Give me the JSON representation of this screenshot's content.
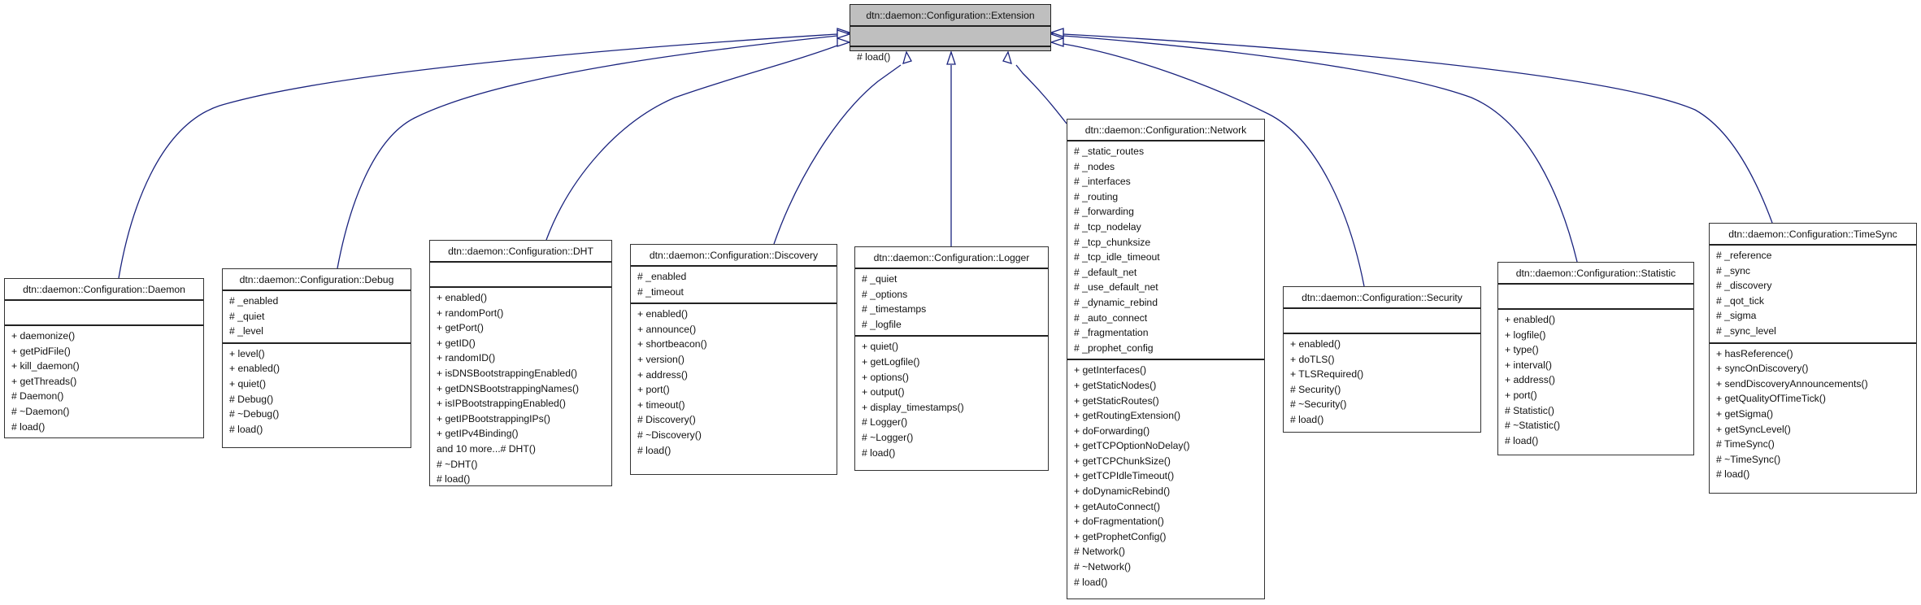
{
  "diagram": {
    "type": "class-inheritance",
    "edge_color": "#1a237e",
    "base_fill": "#bfbfbf",
    "base": {
      "name": "dtn::daemon::Configuration::Extension",
      "attributes": [],
      "operations": [
        "# load()"
      ]
    },
    "classes": [
      {
        "id": "daemon",
        "name": "dtn::daemon::Configuration::Daemon",
        "attributes": [],
        "operations": [
          "+ daemonize()",
          "+ getPidFile()",
          "+ kill_daemon()",
          "+ getThreads()",
          "# Daemon()",
          "# ~Daemon()",
          "# load()"
        ]
      },
      {
        "id": "debug",
        "name": "dtn::daemon::Configuration::Debug",
        "attributes": [
          "# _enabled",
          "# _quiet",
          "# _level"
        ],
        "operations": [
          "+ level()",
          "+ enabled()",
          "+ quiet()",
          "# Debug()",
          "# ~Debug()",
          "# load()"
        ]
      },
      {
        "id": "dht",
        "name": "dtn::daemon::Configuration::DHT",
        "attributes": [],
        "operations": [
          "+ enabled()",
          "+ randomPort()",
          "+ getPort()",
          "+ getID()",
          "+ randomID()",
          "+ isDNSBootstrappingEnabled()",
          "+ getDNSBootstrappingNames()",
          "+ isIPBootstrappingEnabled()",
          "+ getIPBootstrappingIPs()",
          "+ getIPv4Binding()",
          "and 10 more...# DHT()",
          "# ~DHT()",
          "# load()"
        ]
      },
      {
        "id": "discovery",
        "name": "dtn::daemon::Configuration::Discovery",
        "attributes": [
          "# _enabled",
          "# _timeout"
        ],
        "operations": [
          "+ enabled()",
          "+ announce()",
          "+ shortbeacon()",
          "+ version()",
          "+ address()",
          "+ port()",
          "+ timeout()",
          "# Discovery()",
          "# ~Discovery()",
          "# load()"
        ]
      },
      {
        "id": "logger",
        "name": "dtn::daemon::Configuration::Logger",
        "attributes": [
          "# _quiet",
          "# _options",
          "# _timestamps",
          "# _logfile"
        ],
        "operations": [
          "+ quiet()",
          "+ getLogfile()",
          "+ options()",
          "+ output()",
          "+ display_timestamps()",
          "# Logger()",
          "# ~Logger()",
          "# load()"
        ]
      },
      {
        "id": "network",
        "name": "dtn::daemon::Configuration::Network",
        "attributes": [
          "# _static_routes",
          "# _nodes",
          "# _interfaces",
          "# _routing",
          "# _forwarding",
          "# _tcp_nodelay",
          "# _tcp_chunksize",
          "# _tcp_idle_timeout",
          "# _default_net",
          "# _use_default_net",
          "# _dynamic_rebind",
          "# _auto_connect",
          "# _fragmentation",
          "# _prophet_config"
        ],
        "operations": [
          "+ getInterfaces()",
          "+ getStaticNodes()",
          "+ getStaticRoutes()",
          "+ getRoutingExtension()",
          "+ doForwarding()",
          "+ getTCPOptionNoDelay()",
          "+ getTCPChunkSize()",
          "+ getTCPIdleTimeout()",
          "+ doDynamicRebind()",
          "+ getAutoConnect()",
          "+ doFragmentation()",
          "+ getProphetConfig()",
          "# Network()",
          "# ~Network()",
          "# load()"
        ]
      },
      {
        "id": "security",
        "name": "dtn::daemon::Configuration::Security",
        "attributes": [],
        "operations": [
          "+ enabled()",
          "+ doTLS()",
          "+ TLSRequired()",
          "# Security()",
          "# ~Security()",
          "# load()"
        ]
      },
      {
        "id": "statistic",
        "name": "dtn::daemon::Configuration::Statistic",
        "attributes": [],
        "operations": [
          "+ enabled()",
          "+ logfile()",
          "+ type()",
          "+ interval()",
          "+ address()",
          "+ port()",
          "# Statistic()",
          "# ~Statistic()",
          "# load()"
        ]
      },
      {
        "id": "timesync",
        "name": "dtn::daemon::Configuration::TimeSync",
        "attributes": [
          "# _reference",
          "# _sync",
          "# _discovery",
          "# _qot_tick",
          "# _sigma",
          "# _sync_level"
        ],
        "operations": [
          "+ hasReference()",
          "+ syncOnDiscovery()",
          "+ sendDiscoveryAnnouncements()",
          "+ getQualityOfTimeTick()",
          "+ getSigma()",
          "+ getSyncLevel()",
          "# TimeSync()",
          "# ~TimeSync()",
          "# load()"
        ]
      }
    ]
  }
}
